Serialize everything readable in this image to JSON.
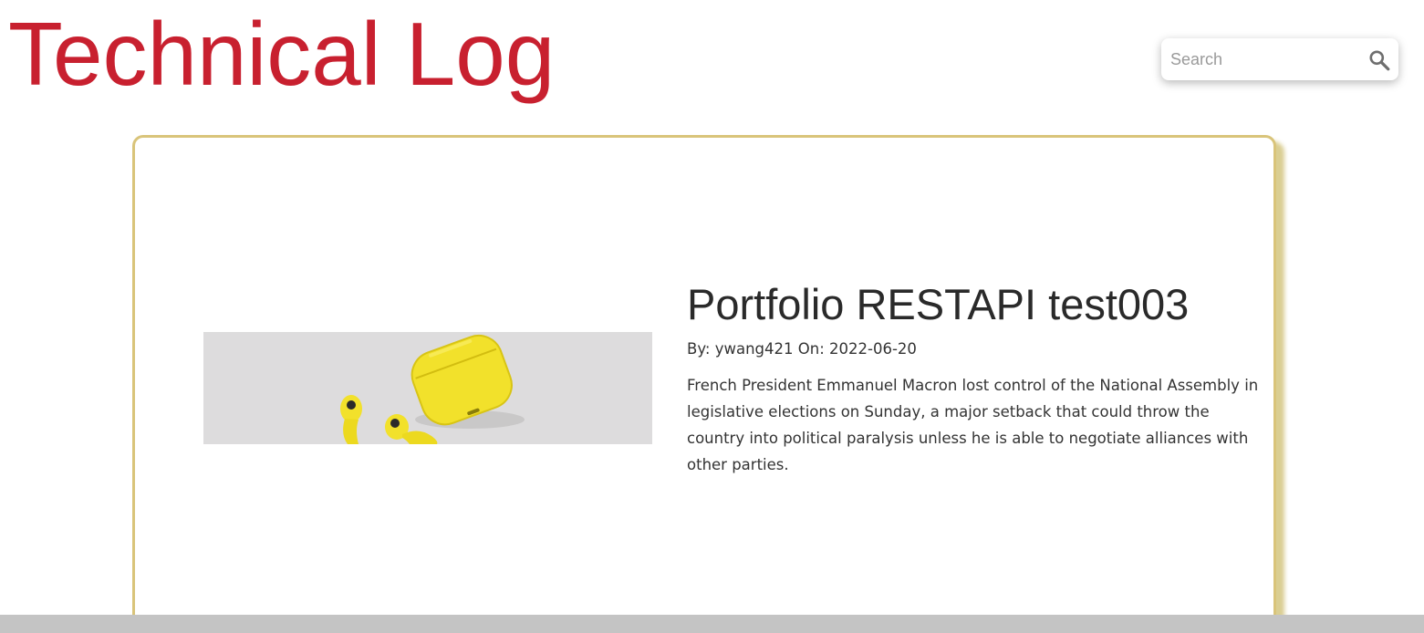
{
  "header": {
    "site_title": "Technical Log"
  },
  "search": {
    "placeholder": "Search",
    "value": "",
    "icon": "search-icon"
  },
  "post": {
    "title": "Portfolio RESTAPI test003",
    "meta_by_label": "By:",
    "author": "ywang421",
    "meta_on_label": "On:",
    "date": "2022-06-20",
    "excerpt": "French President Emmanuel Macron lost control of the National Assembly in legislative elections on Sunday, a major setback that could throw the country into political paralysis unless he is able to negotiate alliances with other parties.",
    "image_subject": "yellow-earbuds-and-case"
  },
  "colors": {
    "title": "#c8202f",
    "card_border": "#d9c47a",
    "card_shadow": "#cdbe6e",
    "image_background": "#dddcdd",
    "earbuds": "#f2e12b",
    "bottom_bar": "#c4c4c4"
  }
}
